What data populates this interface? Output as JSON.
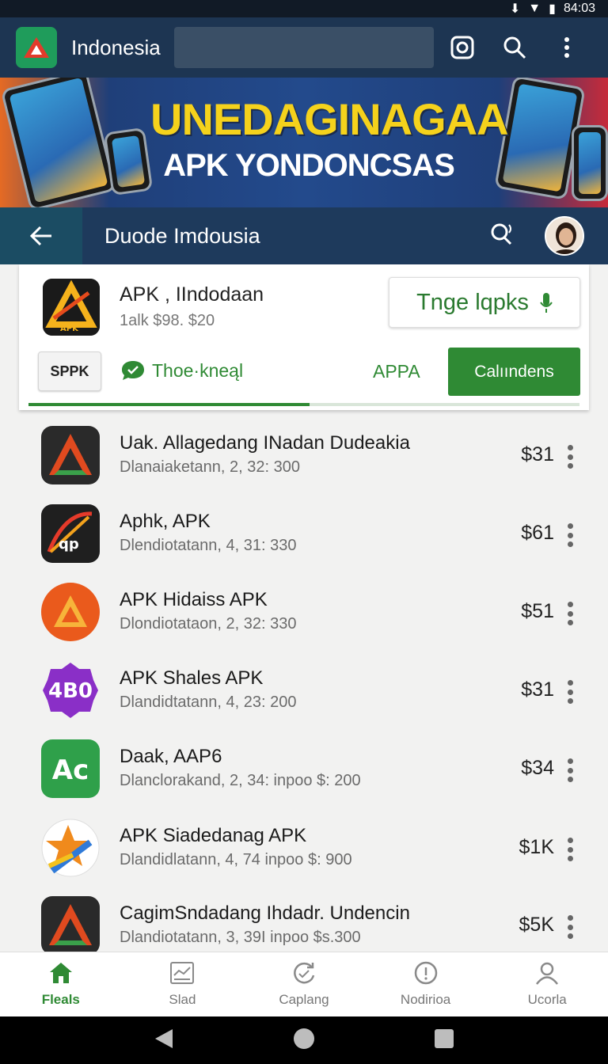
{
  "status_bar": {
    "time": "84:03"
  },
  "app_bar": {
    "title": "Indonesia"
  },
  "banner": {
    "title": "UNEDAGINAGAA",
    "subtitle": "APK YONDONCSAS"
  },
  "sub_bar": {
    "title": "Duode Imdousia"
  },
  "featured": {
    "name": "APK , IIndodaan",
    "price": "1alk $98. $20",
    "action_label": "Tnge lqpks",
    "chip_label": "SPPK",
    "secondary_label": "Thoe·kneąl",
    "link_label": "APPA",
    "primary_button": "Calıındens",
    "progress": 0.51
  },
  "list": [
    {
      "name": "Uak. Allagedang INadan Dudeakia",
      "sub": "Dlanaiaketann, 2, 32: 300",
      "price": "$31",
      "icon": "red-a-dark-icon"
    },
    {
      "name": "Aphk, APK",
      "sub": "Dlendiotatann, 4, 31: 330",
      "price": "$61",
      "icon": "arrow-ap-icon"
    },
    {
      "name": "APK Hidaiss APK",
      "sub": "Dlondiotataon, 2, 32: 330",
      "price": "$51",
      "icon": "orange-triangle-icon"
    },
    {
      "name": "APK Shales APK",
      "sub": "Dlandidtatann, 4, 23: 200",
      "price": "$31",
      "icon": "purple-badge-icon"
    },
    {
      "name": "Daak, AAP6",
      "sub": "Dlanclorakand, 2, 34: inpoo $: 200",
      "price": "$34",
      "icon": "green-ac-icon"
    },
    {
      "name": "APK Siadedanag APK",
      "sub": "Dlandidlatann, 4, 74 inpoo $: 900",
      "price": "$1K",
      "icon": "star-pencil-icon"
    },
    {
      "name": "CagimSndadang Ihdadr. Undencin",
      "sub": "Dlandiotatann, 3, 39I inpoo $s.300",
      "price": "$5K",
      "icon": "red-a-dark-icon"
    }
  ],
  "bottom_nav": [
    {
      "label": "Fleals",
      "icon": "home-icon",
      "active": true
    },
    {
      "label": "Slad",
      "icon": "chart-icon",
      "active": false
    },
    {
      "label": "Caplang",
      "icon": "refresh-icon",
      "active": false
    },
    {
      "label": "Nodirioa",
      "icon": "info-icon",
      "active": false
    },
    {
      "label": "Ucorla",
      "icon": "user-icon",
      "active": false
    }
  ],
  "colors": {
    "accent": "#2f8a34",
    "app_bar": "#1d3552",
    "sub_bar": "#1e3a5c"
  }
}
